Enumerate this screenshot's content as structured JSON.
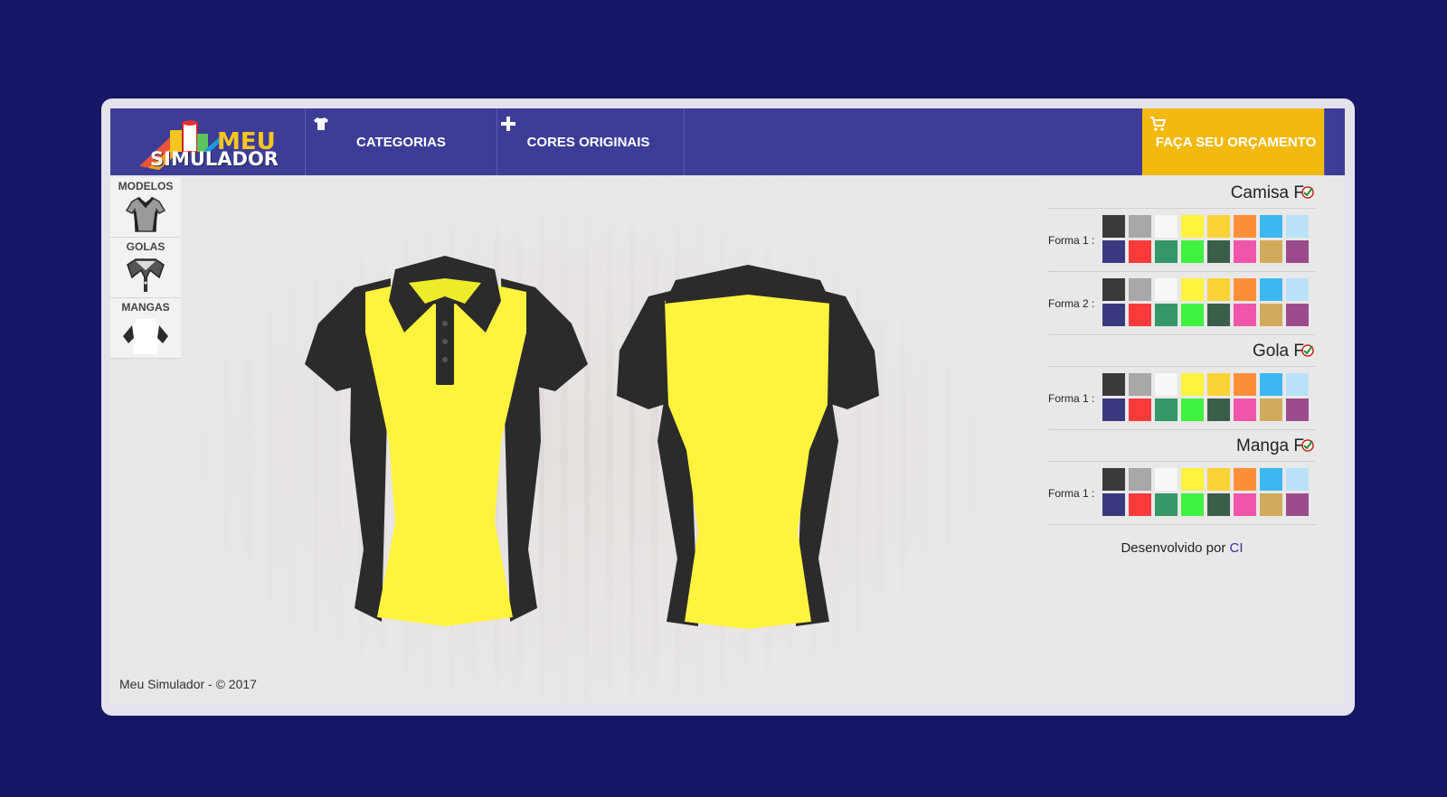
{
  "header": {
    "logo_line1": "MEU",
    "logo_line2": "SIMULADOR",
    "nav": [
      {
        "label": "CATEGORIAS",
        "icon": "tshirt-icon"
      },
      {
        "label": "CORES ORIGINAIS",
        "icon": "plus-icon"
      }
    ],
    "cta": {
      "label": "FAÇA SEU ORÇAMENTO",
      "icon": "cart-icon"
    }
  },
  "tools": [
    {
      "label": "MODELOS",
      "icon": "polo-shirt-icon"
    },
    {
      "label": "GOLAS",
      "icon": "collar-icon"
    },
    {
      "label": "MANGAS",
      "icon": "sleeves-icon"
    }
  ],
  "footer": {
    "copyright": "Meu Simulador - © 2017"
  },
  "panel": {
    "sections": [
      {
        "title": "Camisa F",
        "formas": [
          {
            "label": "Forma 1 :"
          },
          {
            "label": "Forma 2 :"
          }
        ]
      },
      {
        "title": "Gola F",
        "formas": [
          {
            "label": "Forma 1 :"
          }
        ]
      },
      {
        "title": "Manga F",
        "formas": [
          {
            "label": "Forma 1 :"
          }
        ]
      }
    ],
    "palette": [
      "#3a3a3a",
      "#a8a8a8",
      "#f7f7f7",
      "#fff33d",
      "#fbd236",
      "#fb8f38",
      "#3cb7ef",
      "#b9e2f8",
      "#3a3980",
      "#fb3b3b",
      "#359668",
      "#3ff23f",
      "#3b5e4a",
      "#ef56aa",
      "#d2aa5c",
      "#9b4b8c"
    ],
    "credits_text": "Desenvolvido por ",
    "credits_link": "CI"
  },
  "shirt_colors": {
    "body": "#fff33d",
    "sides": "#2b2b2b",
    "collar": "#2b2b2b",
    "sleeves": "#2b2b2b"
  }
}
